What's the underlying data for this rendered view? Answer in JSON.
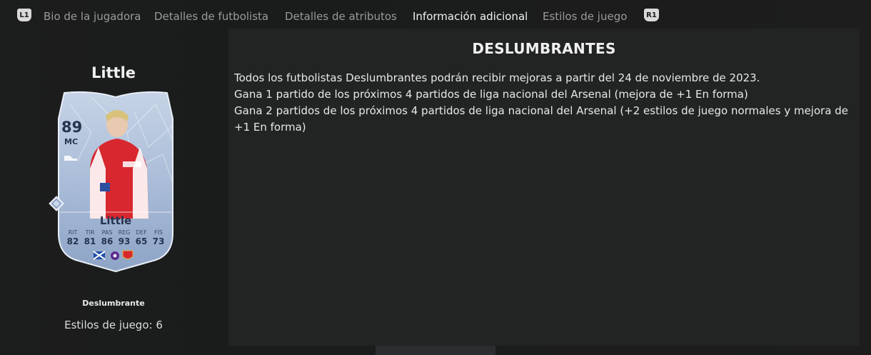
{
  "tabs": {
    "left_button": "L1",
    "right_button": "R1",
    "items": [
      {
        "label": "Bio de la jugadora"
      },
      {
        "label": "Detalles de futbolista"
      },
      {
        "label": "Detalles de atributos"
      },
      {
        "label": "Información adicional",
        "active": true
      },
      {
        "label": "Estilos de juego"
      }
    ]
  },
  "player": {
    "name": "Little",
    "card": {
      "rating": "89",
      "position": "MC",
      "name": "Little",
      "stats": [
        {
          "label": "RIT",
          "value": "82"
        },
        {
          "label": "TIR",
          "value": "81"
        },
        {
          "label": "PAS",
          "value": "86"
        },
        {
          "label": "REG",
          "value": "93"
        },
        {
          "label": "DEF",
          "value": "65"
        },
        {
          "label": "FÍS",
          "value": "73"
        }
      ],
      "icons": [
        "scotland-flag-icon",
        "league-badge-icon",
        "club-crest-icon",
        "boot-icon",
        "diamond-icon"
      ]
    },
    "card_type": "Deslumbrante",
    "play_styles": "Estilos de juego: 6"
  },
  "info": {
    "title": "DESLUMBRANTES",
    "lines": [
      "Todos los futbolistas Deslumbrantes podrán recibir mejoras a partir del 24 de noviembre de 2023.",
      "Gana 1 partido de los próximos 4 partidos de liga nacional del Arsenal (mejora de +1 En forma)",
      "Gana 2 partidos de los próximos 4 partidos de liga nacional del Arsenal (+2 estilos de juego normales y mejora de +1 En forma)"
    ]
  },
  "colors": {
    "background": "#1b1c1c",
    "panel": "#222323",
    "card_base": "#9fb4d3",
    "card_dark": "#26344f",
    "tab_inactive": "#9a9a9a",
    "tab_active": "#f2f2f2"
  }
}
